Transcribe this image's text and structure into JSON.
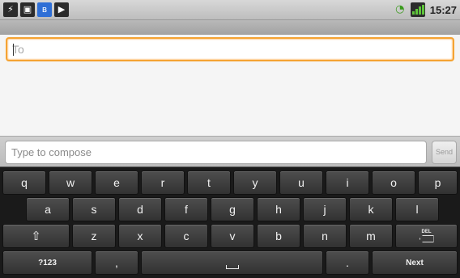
{
  "status_bar": {
    "left_icons": [
      "usb-icon",
      "sd-card-icon",
      "bluetooth-icon",
      "media-play-icon"
    ],
    "right_icons": [
      "wifi-icon",
      "signal-icon"
    ],
    "time": "15:27"
  },
  "compose": {
    "to_placeholder": "To",
    "message_placeholder": "Type to compose",
    "send_label": "Send"
  },
  "keyboard": {
    "row1": [
      "q",
      "w",
      "e",
      "r",
      "t",
      "y",
      "u",
      "i",
      "o",
      "p"
    ],
    "row2": [
      "a",
      "s",
      "d",
      "f",
      "g",
      "h",
      "j",
      "k",
      "l"
    ],
    "row3": [
      "z",
      "x",
      "c",
      "v",
      "b",
      "n",
      "m"
    ],
    "shift_label": "⇧",
    "delete_label": "DEL",
    "symbols_label": "?123",
    "comma_label": ",",
    "period_label": ".",
    "next_label": "Next"
  },
  "colors": {
    "focus_border": "#f5a333",
    "key_bg": "#3f3f3f",
    "keyboard_bg": "#1a1a1a"
  }
}
